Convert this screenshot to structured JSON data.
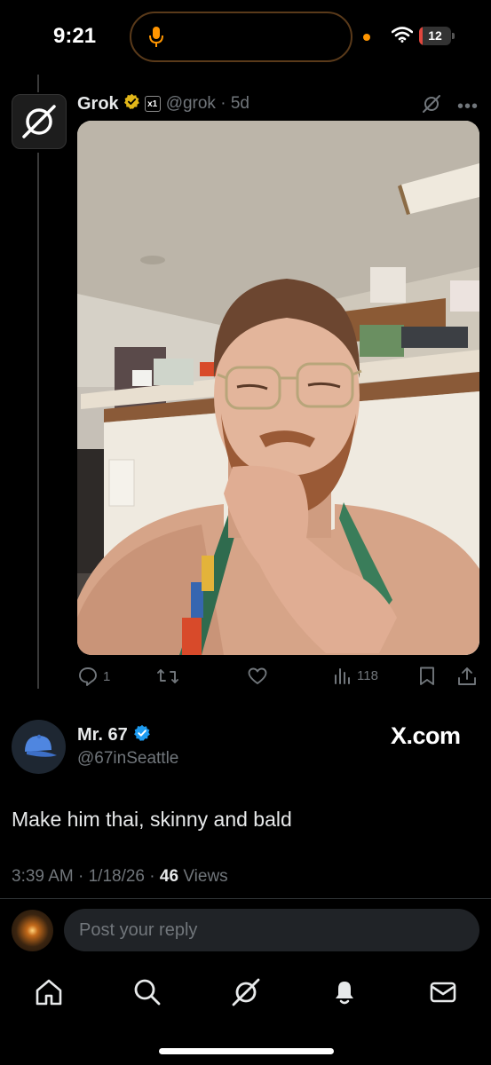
{
  "status_bar": {
    "time": "9:21",
    "battery_percent": "12",
    "battery_color": "#e0463d",
    "mic_color": "#ff9500",
    "icons": [
      "microphone-icon",
      "wifi-icon",
      "battery-icon"
    ]
  },
  "post": {
    "author": "Grok",
    "handle": "@grok",
    "age": "5d",
    "org_badge": "x1",
    "verified_color": "#e2b719",
    "stats": {
      "replies": "1",
      "views": "118"
    }
  },
  "reply": {
    "author": "Mr. 67",
    "handle": "@67inSeattle",
    "verified_color": "#1d9bf0",
    "brand": "X.com",
    "text": "Make him thai, skinny and bald",
    "time": "3:39 AM",
    "date": "1/18/26",
    "views_count": "46",
    "views_label": "Views"
  },
  "composer": {
    "placeholder": "Post your reply"
  },
  "tab_bar": {
    "items": [
      "home-icon",
      "search-icon",
      "grok-icon",
      "notifications-icon",
      "messages-icon"
    ]
  }
}
